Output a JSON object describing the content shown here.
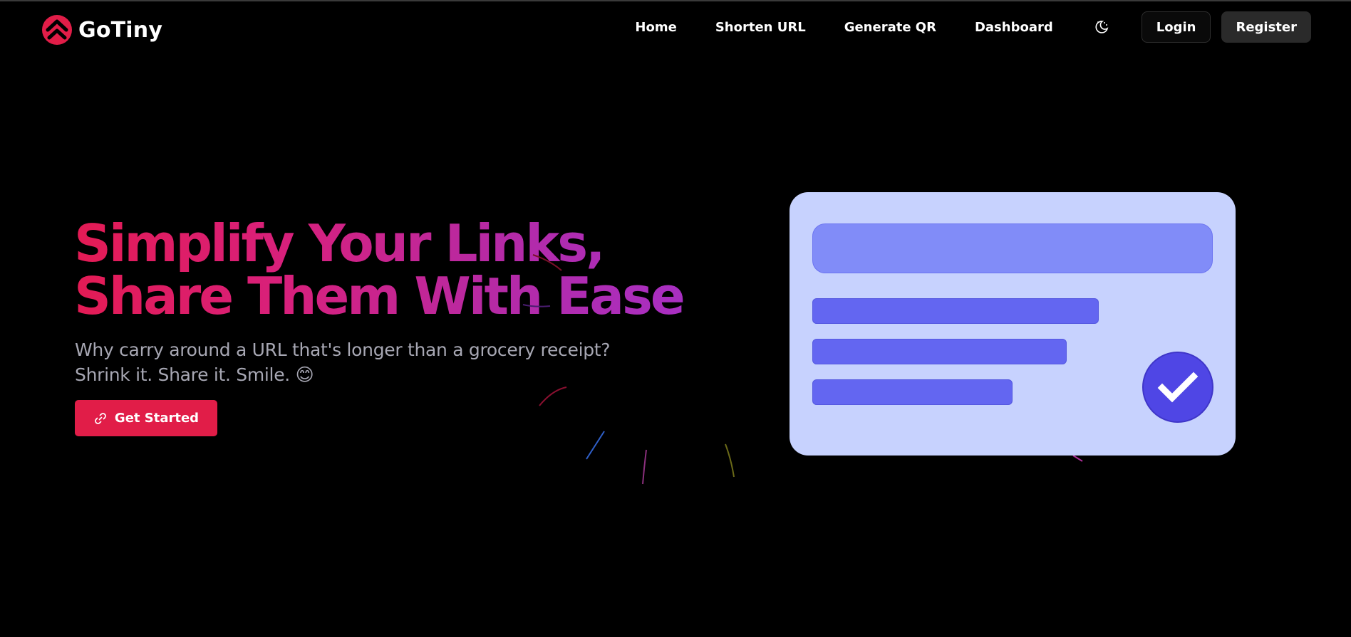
{
  "brand": {
    "name": "GoTiny",
    "logo_icon": "chevron-up-logo-icon",
    "accent": "#e11d48"
  },
  "nav": {
    "links": [
      "Home",
      "Shorten URL",
      "Generate QR",
      "Dashboard"
    ],
    "theme_icon": "moon-sun-icon",
    "login_label": "Login",
    "register_label": "Register"
  },
  "hero": {
    "title_line1": "Simplify Your Links,",
    "title_line2": "Share Them With Ease",
    "subtitle": "Why carry around a URL that's longer than a grocery receipt? Shrink it. Share it. Smile. 😊",
    "cta_label": "Get Started",
    "cta_icon": "link-icon",
    "gradient": [
      "#e31b54",
      "#a82fc2"
    ]
  },
  "illustration": {
    "card_color": "#c7d2fe",
    "input_color": "#818cf8",
    "bar_color": "#6366f1",
    "check_color": "#4f46e5",
    "check_icon": "checkmark-icon"
  }
}
